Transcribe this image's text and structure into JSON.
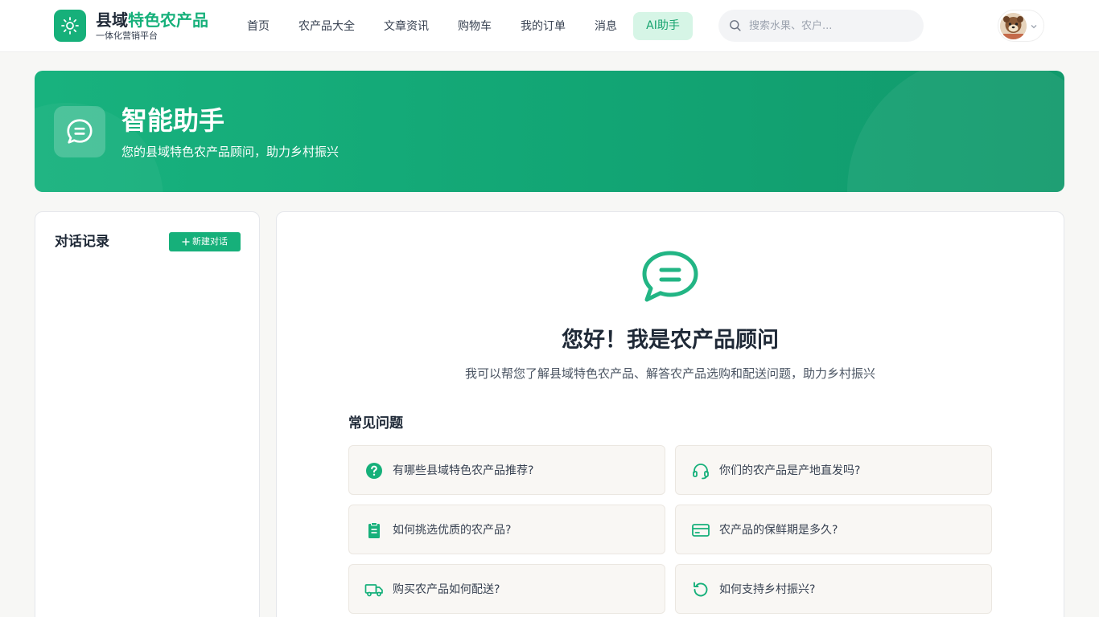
{
  "header": {
    "brand_main": "县域",
    "brand_accent": "特色农产品",
    "brand_sub": "一体化营销平台",
    "nav": [
      "首页",
      "农产品大全",
      "文章资讯",
      "购物车",
      "我的订单",
      "消息"
    ],
    "nav_active": "AI助手",
    "search_placeholder": "搜索水果、农户..."
  },
  "banner": {
    "title": "智能助手",
    "subtitle": "您的县域特色农产品顾问，助力乡村振兴"
  },
  "sidebar": {
    "title": "对话记录",
    "new_chat": "新建对话"
  },
  "main": {
    "greeting": "您好！我是农产品顾问",
    "greeting_sub": "我可以帮您了解县域特色农产品、解答农产品选购和配送问题，助力乡村振兴",
    "faq_title": "常见问题",
    "faqs": [
      {
        "text": "有哪些县域特色农产品推荐?",
        "icon": "question-circle-icon"
      },
      {
        "text": "你们的农产品是产地直发吗?",
        "icon": "headset-icon"
      },
      {
        "text": "如何挑选优质的农产品?",
        "icon": "clipboard-icon"
      },
      {
        "text": "农产品的保鲜期是多久?",
        "icon": "credit-card-icon"
      },
      {
        "text": "购买农产品如何配送?",
        "icon": "truck-icon"
      },
      {
        "text": "如何支持乡村振兴?",
        "icon": "refresh-icon"
      }
    ]
  },
  "colors": {
    "accent": "#16b07a",
    "accent_light": "#d6f5e6",
    "card_bg": "#f9f7f4"
  }
}
